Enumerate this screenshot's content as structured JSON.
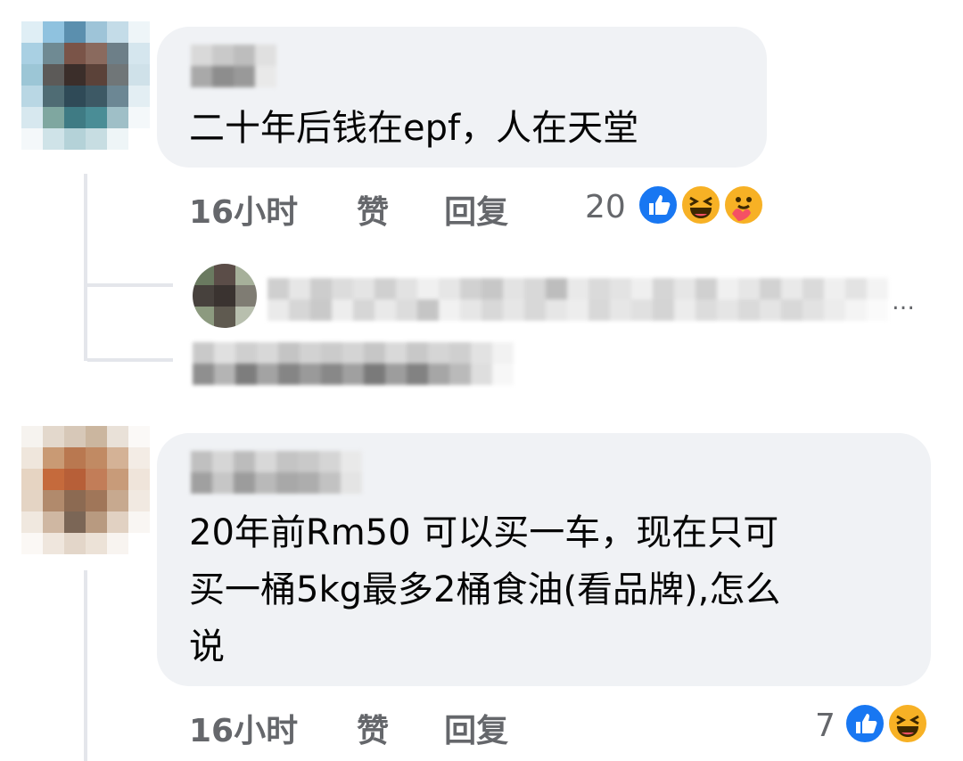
{
  "comments": [
    {
      "name_glyph": "个彩",
      "text": "二十年后钱在epf，人在天堂",
      "time": "16小时",
      "like_label": "赞",
      "reply_label": "回复",
      "reaction_count": "20",
      "reactions": [
        "like-icon",
        "haha-icon",
        "care-icon"
      ]
    },
    {
      "text": "20年前Rm50 可以买一车，现在只可\n买一桶5kg最多2桶食油(看品牌),怎么\n说",
      "time": "16小时",
      "like_label": "赞",
      "reply_label": "回复",
      "reaction_count": "7",
      "reactions": [
        "like-icon",
        "haha-icon"
      ]
    }
  ],
  "reply_preview": {
    "partial_text": "家美级客",
    "ellipsis": "…"
  },
  "colors": {
    "bubble": "#f0f2f5",
    "meta_text": "#65676b",
    "like_blue": "#1877f2",
    "haha_yellow": "#f7b125"
  }
}
